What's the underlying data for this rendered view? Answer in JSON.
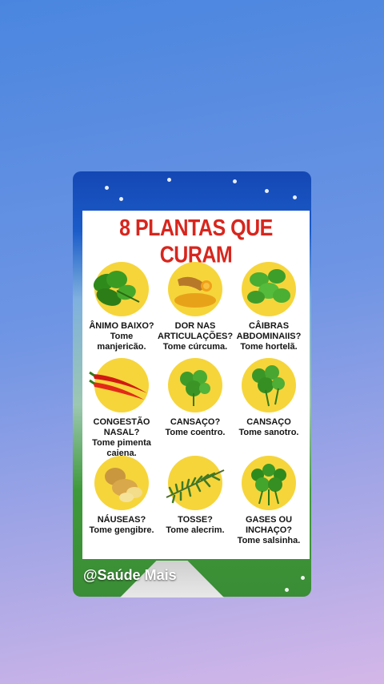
{
  "poster": {
    "title": "8 PLANTAS QUE CURAM"
  },
  "plants": [
    {
      "question": "ÂNIMO BAIXO?",
      "answer_line1": "Tome",
      "answer_line2": "manjericão.",
      "icon": "basil-icon"
    },
    {
      "question": "DOR NAS ARTICULAÇÕES?",
      "answer_line1": "Tome cúrcuma.",
      "answer_line2": "",
      "icon": "turmeric-icon"
    },
    {
      "question": "CÂIBRAS ABDOMINAIIS?",
      "answer_line1": "Tome hortelã.",
      "answer_line2": "",
      "icon": "mint-icon"
    },
    {
      "question": "CONGESTÃO NASAL?",
      "answer_line1": "Tome pimenta",
      "answer_line2": "caiena.",
      "icon": "chili-icon"
    },
    {
      "question": "CANSAÇO?",
      "answer_line1": "Tome coentro.",
      "answer_line2": "",
      "icon": "coriander-icon"
    },
    {
      "question": "CANSAÇO",
      "answer_line1": "Tome sanotro.",
      "answer_line2": "",
      "icon": "cilantro-icon"
    },
    {
      "question": "NÁUSEAS?",
      "answer_line1": "Tome gengibre.",
      "answer_line2": "",
      "icon": "ginger-icon"
    },
    {
      "question": "TOSSE?",
      "answer_line1": "Tome alecrim.",
      "answer_line2": "",
      "icon": "rosemary-icon"
    },
    {
      "question": "GASES OU INCHAÇO?",
      "answer_line1": "Tome salsinha.",
      "answer_line2": "",
      "icon": "parsley-icon"
    }
  ],
  "watermark": "@Saúde Mais",
  "colors": {
    "title": "#d7261e",
    "circle": "#f6d53b",
    "text": "#151515"
  }
}
